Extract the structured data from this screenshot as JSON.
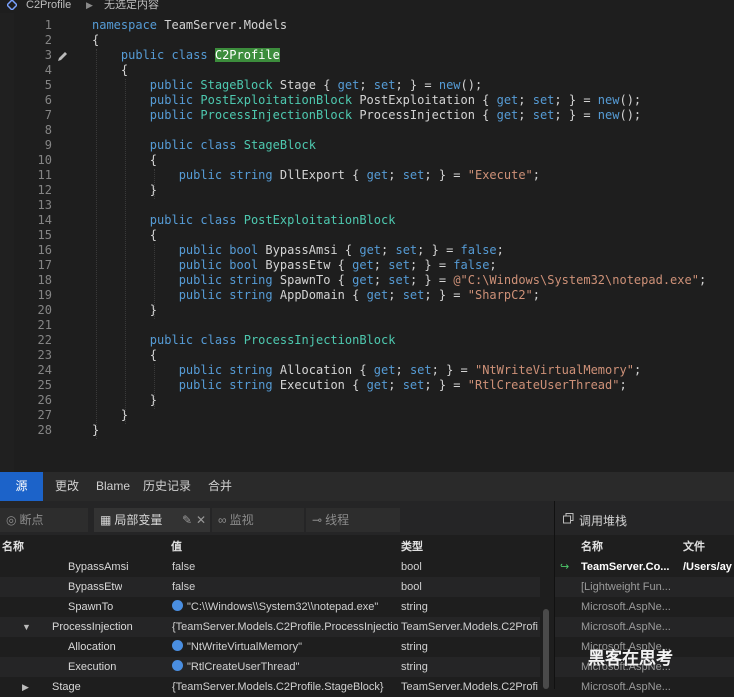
{
  "breadcrumb": {
    "file": "C2Profile",
    "selection": "无选定内容"
  },
  "editor": {
    "lines": [
      [
        [
          "namespace ",
          "kw"
        ],
        [
          "TeamServer.Models",
          ""
        ]
      ],
      [
        [
          "{",
          ""
        ]
      ],
      [
        [
          "    ",
          ""
        ],
        [
          "public ",
          "kw"
        ],
        [
          "class ",
          "kw"
        ],
        [
          "C2Profile",
          "hl"
        ]
      ],
      [
        [
          "    {",
          ""
        ]
      ],
      [
        [
          "        ",
          ""
        ],
        [
          "public ",
          "kw"
        ],
        [
          "StageBlock",
          "ty"
        ],
        [
          " Stage { ",
          ""
        ],
        [
          "get",
          "kw"
        ],
        [
          "; ",
          ""
        ],
        [
          "set",
          "kw"
        ],
        [
          "; } = ",
          ""
        ],
        [
          "new",
          "kw"
        ],
        [
          "();",
          ""
        ]
      ],
      [
        [
          "        ",
          ""
        ],
        [
          "public ",
          "kw"
        ],
        [
          "PostExploitationBlock",
          "ty"
        ],
        [
          " PostExploitation { ",
          ""
        ],
        [
          "get",
          "kw"
        ],
        [
          "; ",
          ""
        ],
        [
          "set",
          "kw"
        ],
        [
          "; } = ",
          ""
        ],
        [
          "new",
          "kw"
        ],
        [
          "();",
          ""
        ]
      ],
      [
        [
          "        ",
          ""
        ],
        [
          "public ",
          "kw"
        ],
        [
          "ProcessInjectionBlock",
          "ty"
        ],
        [
          " ProcessInjection { ",
          ""
        ],
        [
          "get",
          "kw"
        ],
        [
          "; ",
          ""
        ],
        [
          "set",
          "kw"
        ],
        [
          "; } = ",
          ""
        ],
        [
          "new",
          "kw"
        ],
        [
          "();",
          ""
        ]
      ],
      [],
      [
        [
          "        ",
          ""
        ],
        [
          "public ",
          "kw"
        ],
        [
          "class ",
          "kw"
        ],
        [
          "StageBlock",
          "ty"
        ]
      ],
      [
        [
          "        {",
          ""
        ]
      ],
      [
        [
          "            ",
          ""
        ],
        [
          "public ",
          "kw"
        ],
        [
          "string",
          "kw"
        ],
        [
          " DllExport { ",
          ""
        ],
        [
          "get",
          "kw"
        ],
        [
          "; ",
          ""
        ],
        [
          "set",
          "kw"
        ],
        [
          "; } = ",
          ""
        ],
        [
          "\"Execute\"",
          "st"
        ],
        [
          ";",
          ""
        ]
      ],
      [
        [
          "        }",
          ""
        ]
      ],
      [],
      [
        [
          "        ",
          ""
        ],
        [
          "public ",
          "kw"
        ],
        [
          "class ",
          "kw"
        ],
        [
          "PostExploitationBlock",
          "ty"
        ]
      ],
      [
        [
          "        {",
          ""
        ]
      ],
      [
        [
          "            ",
          ""
        ],
        [
          "public ",
          "kw"
        ],
        [
          "bool",
          "kw"
        ],
        [
          " BypassAmsi { ",
          ""
        ],
        [
          "get",
          "kw"
        ],
        [
          "; ",
          ""
        ],
        [
          "set",
          "kw"
        ],
        [
          "; } = ",
          ""
        ],
        [
          "false",
          "kw"
        ],
        [
          ";",
          ""
        ]
      ],
      [
        [
          "            ",
          ""
        ],
        [
          "public ",
          "kw"
        ],
        [
          "bool",
          "kw"
        ],
        [
          " BypassEtw { ",
          ""
        ],
        [
          "get",
          "kw"
        ],
        [
          "; ",
          ""
        ],
        [
          "set",
          "kw"
        ],
        [
          "; } = ",
          ""
        ],
        [
          "false",
          "kw"
        ],
        [
          ";",
          ""
        ]
      ],
      [
        [
          "            ",
          ""
        ],
        [
          "public ",
          "kw"
        ],
        [
          "string",
          "kw"
        ],
        [
          " SpawnTo { ",
          ""
        ],
        [
          "get",
          "kw"
        ],
        [
          "; ",
          ""
        ],
        [
          "set",
          "kw"
        ],
        [
          "; } = ",
          ""
        ],
        [
          "@\"C:\\Windows\\System32\\notepad.exe\"",
          "st"
        ],
        [
          ";",
          ""
        ]
      ],
      [
        [
          "            ",
          ""
        ],
        [
          "public ",
          "kw"
        ],
        [
          "string",
          "kw"
        ],
        [
          " AppDomain { ",
          ""
        ],
        [
          "get",
          "kw"
        ],
        [
          "; ",
          ""
        ],
        [
          "set",
          "kw"
        ],
        [
          "; } = ",
          ""
        ],
        [
          "\"SharpC2\"",
          "st"
        ],
        [
          ";",
          ""
        ]
      ],
      [
        [
          "        }",
          ""
        ]
      ],
      [],
      [
        [
          "        ",
          ""
        ],
        [
          "public ",
          "kw"
        ],
        [
          "class ",
          "kw"
        ],
        [
          "ProcessInjectionBlock",
          "ty"
        ]
      ],
      [
        [
          "        {",
          ""
        ]
      ],
      [
        [
          "            ",
          ""
        ],
        [
          "public ",
          "kw"
        ],
        [
          "string",
          "kw"
        ],
        [
          " Allocation { ",
          ""
        ],
        [
          "get",
          "kw"
        ],
        [
          "; ",
          ""
        ],
        [
          "set",
          "kw"
        ],
        [
          "; } = ",
          ""
        ],
        [
          "\"NtWriteVirtualMemory\"",
          "st"
        ],
        [
          ";",
          ""
        ]
      ],
      [
        [
          "            ",
          ""
        ],
        [
          "public ",
          "kw"
        ],
        [
          "string",
          "kw"
        ],
        [
          " Execution { ",
          ""
        ],
        [
          "get",
          "kw"
        ],
        [
          "; ",
          ""
        ],
        [
          "set",
          "kw"
        ],
        [
          "; } = ",
          ""
        ],
        [
          "\"RtlCreateUserThread\"",
          "st"
        ],
        [
          ";",
          ""
        ]
      ],
      [
        [
          "        }",
          ""
        ]
      ],
      [
        [
          "    }",
          ""
        ]
      ],
      [
        [
          "}",
          ""
        ]
      ]
    ]
  },
  "tabs": [
    "源",
    "更改",
    "Blame",
    "历史记录",
    "合并"
  ],
  "debug_tabs": [
    "断点",
    "局部变量",
    "监视",
    "线程"
  ],
  "locals": {
    "columns": [
      "名称",
      "值",
      "类型"
    ],
    "rows": [
      {
        "name": "BypassAmsi",
        "value": "false",
        "type": "bool",
        "indent": 2,
        "expander": "",
        "vis": false
      },
      {
        "name": "BypassEtw",
        "value": "false",
        "type": "bool",
        "indent": 2,
        "expander": "",
        "vis": false
      },
      {
        "name": "SpawnTo",
        "value": "\"C:\\\\Windows\\\\System32\\\\notepad.exe\"",
        "type": "string",
        "indent": 2,
        "expander": "",
        "vis": true
      },
      {
        "name": "ProcessInjection",
        "value": "{TeamServer.Models.C2Profile.ProcessInjectio",
        "type": "TeamServer.Models.C2Profi",
        "indent": 1,
        "expander": "▼",
        "vis": false
      },
      {
        "name": "Allocation",
        "value": "\"NtWriteVirtualMemory\"",
        "type": "string",
        "indent": 2,
        "expander": "",
        "vis": true
      },
      {
        "name": "Execution",
        "value": "\"RtlCreateUserThread\"",
        "type": "string",
        "indent": 2,
        "expander": "",
        "vis": true
      },
      {
        "name": "Stage",
        "value": "{TeamServer.Models.C2Profile.StageBlock}",
        "type": "TeamServer.Models.C2Profi",
        "indent": 1,
        "expander": "▶",
        "vis": false
      }
    ]
  },
  "callstack": {
    "title": "调用堆栈",
    "columns": [
      "名称",
      "文件"
    ],
    "rows": [
      {
        "name": "TeamServer.Co...",
        "file": "/Users/ay",
        "current": true
      },
      {
        "name": "[Lightweight Fun...",
        "file": "",
        "current": false
      },
      {
        "name": "Microsoft.AspNe...",
        "file": "",
        "current": false
      },
      {
        "name": "Microsoft.AspNe...",
        "file": "",
        "current": false
      },
      {
        "name": "Microsoft.AspNe...",
        "file": "",
        "current": false
      },
      {
        "name": "Microsoft.AspNe...",
        "file": "",
        "current": false
      },
      {
        "name": "Microsoft.AspNe...",
        "file": "",
        "current": false
      }
    ]
  },
  "watermark": "黑客在思考"
}
